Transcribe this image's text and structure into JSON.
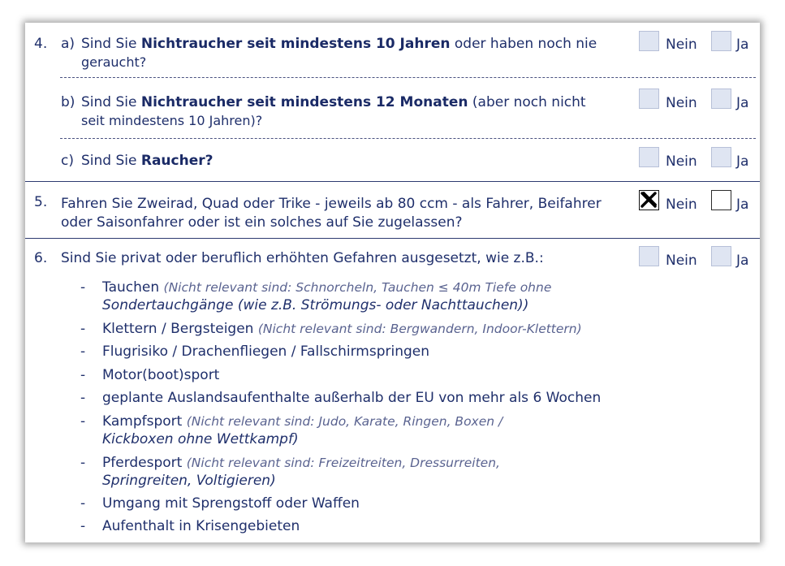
{
  "q4": {
    "number": "4.",
    "a": {
      "letter": "a)",
      "pre": "Sind Sie ",
      "bold": "Nichtraucher seit mindestens 10 Jahren",
      "post": " oder haben noch nie",
      "line2": "geraucht?",
      "nein": "Nein",
      "ja": "Ja"
    },
    "b": {
      "letter": "b)",
      "pre": "Sind Sie ",
      "bold": "Nichtraucher seit mindestens 12 Monaten",
      "post": " (aber noch nicht",
      "line2": "seit mindestens 10 Jahren)?",
      "nein": "Nein",
      "ja": "Ja"
    },
    "c": {
      "letter": "c)",
      "pre": "Sind Sie ",
      "bold": "Raucher?",
      "nein": "Nein",
      "ja": "Ja"
    }
  },
  "q5": {
    "number": "5.",
    "line1": "Fahren Sie Zweirad, Quad oder Trike - jeweils ab 80 ccm - als Fahrer, Beifahrer",
    "line2": "oder Saisonfahrer oder ist ein solches auf Sie zugelassen?",
    "nein": "Nein",
    "ja": "Ja",
    "nein_checked": true
  },
  "q6": {
    "number": "6.",
    "text": "Sind Sie privat oder beruflich erhöhten Gefahren ausgesetzt, wie z.B.:",
    "nein": "Nein",
    "ja": "Ja",
    "bullet": "-",
    "items": [
      {
        "label": "Tauchen",
        "hint1": "(Nicht relevant sind: Schnorcheln, Tauchen ≤ 40m Tiefe ohne",
        "hint2": "Sondertauchgänge (wie z.B. Strömungs- oder Nachttauchen))"
      },
      {
        "label": "Klettern / Bergsteigen",
        "hint1": "(Nicht relevant sind: Bergwandern, Indoor-Klettern)"
      },
      {
        "label": "Flugrisiko / Drachenfliegen / Fallschirmspringen"
      },
      {
        "label": "Motor(boot)sport"
      },
      {
        "label": "geplante Auslandsaufenthalte außerhalb der EU von mehr als 6 Wochen"
      },
      {
        "label": "Kampfsport",
        "hint1": "(Nicht relevant sind: Judo, Karate, Ringen, Boxen /",
        "hint2": "Kickboxen ohne Wettkampf)"
      },
      {
        "label": "Pferdesport",
        "hint1": "(Nicht relevant sind: Freizeitreiten, Dressurreiten,",
        "hint2": "Springreiten, Voltigieren)"
      },
      {
        "label": "Umgang mit Sprengstoff oder Waffen"
      },
      {
        "label": "Aufenthalt in Krisengebieten"
      }
    ]
  },
  "colors": {
    "text": "#1f2f6b",
    "checkbox_fill": "#dfe5f2",
    "hint": "#5a6390"
  }
}
